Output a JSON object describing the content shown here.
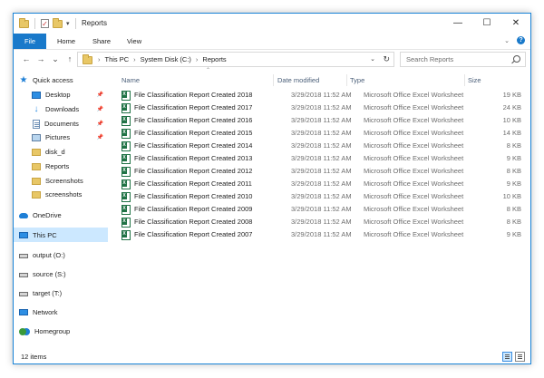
{
  "window": {
    "title": "Reports",
    "minimize_glyph": "—",
    "maximize_glyph": "☐",
    "close_glyph": "✕",
    "quick_access_dropdown": "▾"
  },
  "ribbon": {
    "tabs": [
      {
        "label": "File"
      },
      {
        "label": "Home"
      },
      {
        "label": "Share"
      },
      {
        "label": "View"
      }
    ],
    "help_label": "?",
    "expand_glyph": "⌄"
  },
  "address": {
    "back_glyph": "←",
    "forward_glyph": "→",
    "recent_glyph": "⌄",
    "up_glyph": "↑",
    "breadcrumbs": [
      "This PC",
      "System Disk (C:)",
      "Reports"
    ],
    "separator": "›",
    "dropdown_glyph": "⌄",
    "refresh_glyph": "↻"
  },
  "search": {
    "placeholder": "Search Reports"
  },
  "nav": {
    "items": [
      {
        "label": "Quick access",
        "icon": "quick-access-star-icon"
      },
      {
        "label": "Desktop",
        "icon": "desktop-icon",
        "pinned": true
      },
      {
        "label": "Downloads",
        "icon": "downloads-icon",
        "pinned": true
      },
      {
        "label": "Documents",
        "icon": "documents-icon",
        "pinned": true
      },
      {
        "label": "Pictures",
        "icon": "pictures-icon",
        "pinned": true
      },
      {
        "label": "disk_d",
        "icon": "folder-icon"
      },
      {
        "label": "Reports",
        "icon": "folder-icon"
      },
      {
        "label": "Screenshots",
        "icon": "folder-icon"
      },
      {
        "label": "screenshots",
        "icon": "folder-icon"
      },
      {
        "label": "OneDrive",
        "icon": "onedrive-icon"
      },
      {
        "label": "This PC",
        "icon": "this-pc-icon",
        "selected": true
      },
      {
        "label": "output (O:)",
        "icon": "drive-icon"
      },
      {
        "label": "source (S:)",
        "icon": "drive-icon"
      },
      {
        "label": "target (T:)",
        "icon": "drive-icon"
      },
      {
        "label": "Network",
        "icon": "network-icon"
      },
      {
        "label": "Homegroup",
        "icon": "homegroup-icon"
      }
    ],
    "pin_glyph": "📌"
  },
  "columns": {
    "name": "Name",
    "date": "Date modified",
    "type": "Type",
    "size": "Size",
    "sort_glyph": "⌃"
  },
  "files": [
    {
      "name": "File Classification Report Created 2018",
      "date": "3/29/2018 11:52 AM",
      "type": "Microsoft Office Excel Worksheet",
      "size": "19 KB"
    },
    {
      "name": "File Classification Report Created 2017",
      "date": "3/29/2018 11:52 AM",
      "type": "Microsoft Office Excel Worksheet",
      "size": "24 KB"
    },
    {
      "name": "File Classification Report Created 2016",
      "date": "3/29/2018 11:52 AM",
      "type": "Microsoft Office Excel Worksheet",
      "size": "10 KB"
    },
    {
      "name": "File Classification Report Created 2015",
      "date": "3/29/2018 11:52 AM",
      "type": "Microsoft Office Excel Worksheet",
      "size": "14 KB"
    },
    {
      "name": "File Classification Report Created 2014",
      "date": "3/29/2018 11:52 AM",
      "type": "Microsoft Office Excel Worksheet",
      "size": "8 KB"
    },
    {
      "name": "File Classification Report Created 2013",
      "date": "3/29/2018 11:52 AM",
      "type": "Microsoft Office Excel Worksheet",
      "size": "9 KB"
    },
    {
      "name": "File Classification Report Created 2012",
      "date": "3/29/2018 11:52 AM",
      "type": "Microsoft Office Excel Worksheet",
      "size": "8 KB"
    },
    {
      "name": "File Classification Report Created 2011",
      "date": "3/29/2018 11:52 AM",
      "type": "Microsoft Office Excel Worksheet",
      "size": "9 KB"
    },
    {
      "name": "File Classification Report Created 2010",
      "date": "3/29/2018 11:52 AM",
      "type": "Microsoft Office Excel Worksheet",
      "size": "10 KB"
    },
    {
      "name": "File Classification Report Created 2009",
      "date": "3/29/2018 11:52 AM",
      "type": "Microsoft Office Excel Worksheet",
      "size": "8 KB"
    },
    {
      "name": "File Classification Report Created 2008",
      "date": "3/29/2018 11:52 AM",
      "type": "Microsoft Office Excel Worksheet",
      "size": "8 KB"
    },
    {
      "name": "File Classification Report Created 2007",
      "date": "3/29/2018 11:52 AM",
      "type": "Microsoft Office Excel Worksheet",
      "size": "9 KB"
    }
  ],
  "status": {
    "item_count": "12 items"
  },
  "colors": {
    "accent": "#1979ca",
    "selection": "#cce8ff",
    "border": "#1883d7"
  }
}
